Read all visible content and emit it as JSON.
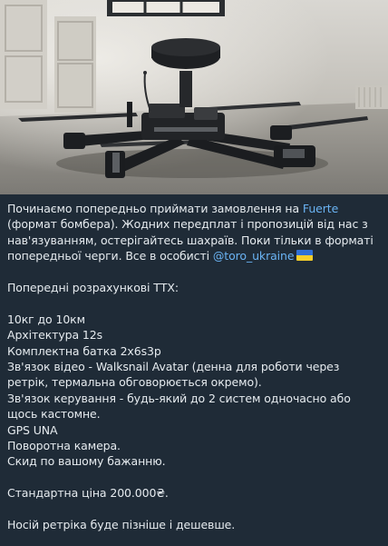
{
  "image": {
    "subject": "drone-photo"
  },
  "message": {
    "intro_before_link": "Починаємо попередньо приймати замовлення на ",
    "intro_link": "Fuerte",
    "intro_after_link": " (формат бомбера). Жодних передплат і пропозицій від нас з нав'язуванням, остерігайтесь шахраїв. Поки тільки в форматі попередньої черги. Все в особисті ",
    "contact_link": "@toro_ukraine",
    "flag_icon": "ukraine-flag-icon",
    "specs_heading": "Попередні розрахункові ТТХ:",
    "specs": [
      "10кг до 10км",
      "Архітектура 12s",
      "Комплектна батка 2х6s3p",
      "Зв'язок відео - Walksnail Avatar (денна для роботи через ретрік, термальна обговорюється окремо).",
      "Зв'язок керування - будь-який до 2 систем одночасно або щось кастомне.",
      "GPS UNA",
      "Поворотна камера.",
      "Скид по вашому бажанню."
    ],
    "price": "Стандартна ціна 200.000₴.",
    "footer_note": "Носій ретріка буде пізніше і дешевше."
  },
  "colors": {
    "background": "#1f2b37",
    "text": "#e6ebef",
    "link": "#6ab3f3"
  }
}
